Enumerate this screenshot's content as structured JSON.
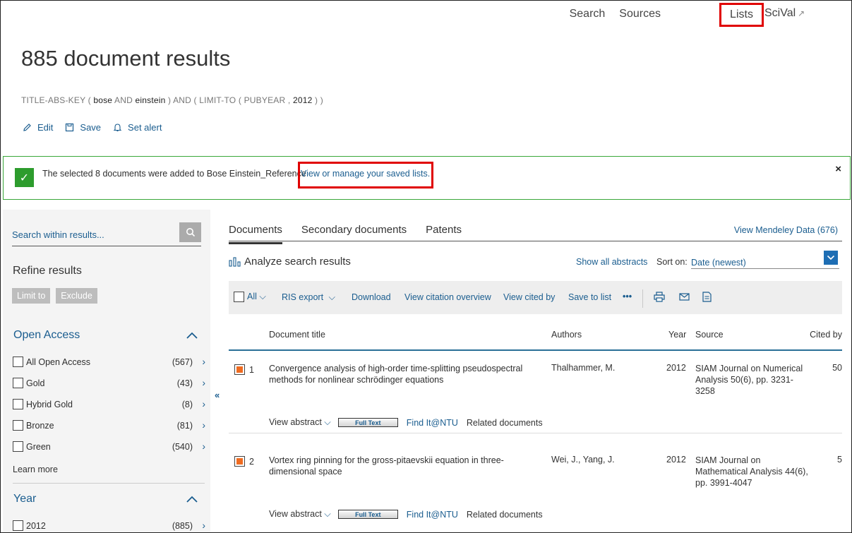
{
  "nav": {
    "search": "Search",
    "sources": "Sources",
    "lists": "Lists",
    "scival": "SciVal",
    "scival_ext": "↗"
  },
  "header": {
    "title": "885 document results",
    "query": {
      "p1": "TITLE-ABS-KEY ( ",
      "t1": "bose",
      "p2": "  AND ",
      "t2": "einstein",
      "p3": " )  AND  ( LIMIT-TO ( PUBYEAR ,  ",
      "t3": "2012",
      "p4": " ) )"
    },
    "actions": {
      "edit": "Edit",
      "save": "Save",
      "set_alert": "Set alert"
    }
  },
  "alert": {
    "message": "The selected 8 documents were added to Bose Einstein_Reference",
    "link": "View or manage your saved lists.",
    "close": "×",
    "check": "✓"
  },
  "sidebar": {
    "search_placeholder": "Search within results...",
    "refine_title": "Refine results",
    "limit_to": "Limit to",
    "exclude": "Exclude",
    "open_access": {
      "title": "Open Access",
      "items": [
        {
          "label": "All Open Access",
          "count": "(567)"
        },
        {
          "label": "Gold",
          "count": "(43)"
        },
        {
          "label": "Hybrid Gold",
          "count": "(8)"
        },
        {
          "label": "Bronze",
          "count": "(81)"
        },
        {
          "label": "Green",
          "count": "(540)"
        }
      ],
      "learn_more": "Learn more"
    },
    "year": {
      "title": "Year",
      "items": [
        {
          "label": "2012",
          "count": "(885)"
        }
      ]
    }
  },
  "main": {
    "tabs": [
      "Documents",
      "Secondary documents",
      "Patents"
    ],
    "mendeley": "View Mendeley Data (676)",
    "analyze": "Analyze search results",
    "show_abstracts": "Show all abstracts",
    "sort_label": "Sort on:",
    "sort_value": "Date (newest)",
    "toolbar": {
      "all": "All",
      "ris_export": "RIS export",
      "download": "Download",
      "citation_overview": "View citation overview",
      "cited_by": "View cited by",
      "save_to_list": "Save to list",
      "more": "•••"
    },
    "columns": {
      "title": "Document title",
      "authors": "Authors",
      "year": "Year",
      "source": "Source",
      "cited": "Cited by"
    },
    "rows": [
      {
        "num": "1",
        "title": "Convergence analysis of high-order time-splitting pseudospectral methods for nonlinear schrödinger equations",
        "authors": "Thalhammer, M.",
        "year": "2012",
        "source": "SIAM Journal on Numerical Analysis 50(6), pp. 3231-3258",
        "cited": "50",
        "view_abstract": "View abstract",
        "full_text": "Full Text",
        "find_it": "Find It@NTU",
        "related": "Related documents"
      },
      {
        "num": "2",
        "title": "Vortex ring pinning for the gross-pitaevskii equation in three-dimensional space",
        "authors": "Wei, J., Yang, J.",
        "year": "2012",
        "source": "SIAM Journal on Mathematical Analysis 44(6), pp. 3991-4047",
        "cited": "5",
        "view_abstract": "View abstract",
        "full_text": "Full Text",
        "find_it": "Find It@NTU",
        "related": "Related documents"
      }
    ]
  },
  "colors": {
    "link": "#1a5d8f",
    "highlight": "#e00000",
    "success": "#2d9c2d",
    "checked": "#ef6c21"
  }
}
